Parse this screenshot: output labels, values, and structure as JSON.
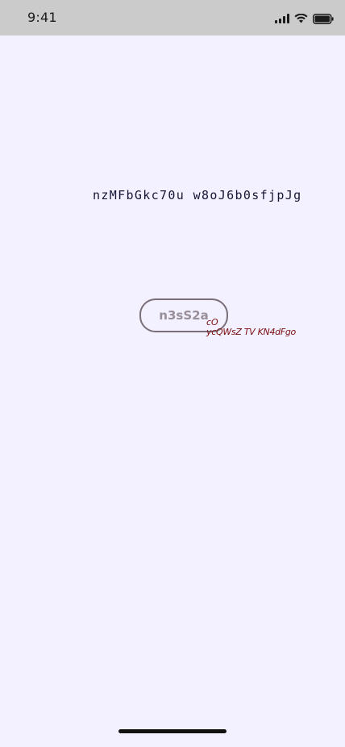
{
  "status_bar": {
    "time": "9:41",
    "icons": [
      "signal-icon",
      "wifi-icon",
      "battery-icon"
    ]
  },
  "content": {
    "mono_text": "nzMFbGkc70u w8oJ6b0sfjpJg",
    "button_label": "n3sS2a",
    "note_line1": "cO",
    "note_line2": "ycQWsZ TV KN4dFgo"
  },
  "colors": {
    "background": "#f3f0ff",
    "status_bar": "#cbcbcb",
    "mono_text": "#141532",
    "button_border": "#7a6f78",
    "button_text": "#9a8f98",
    "note_text": "#7a0d0d"
  }
}
